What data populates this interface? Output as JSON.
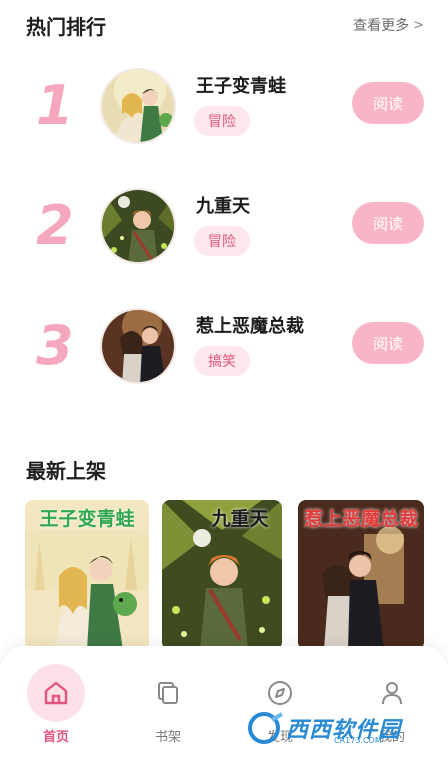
{
  "hot_section": {
    "title": "热门排行",
    "more": "查看更多"
  },
  "rankings": [
    {
      "rank": "1",
      "title": "王子变青蛙",
      "genre": "冒险",
      "action": "阅读"
    },
    {
      "rank": "2",
      "title": "九重天",
      "genre": "冒险",
      "action": "阅读"
    },
    {
      "rank": "3",
      "title": "惹上恶魔总裁",
      "genre": "搞笑",
      "action": "阅读"
    }
  ],
  "new_section": {
    "title": "最新上架",
    "cards": [
      {
        "title": "王子变青蛙",
        "title_color": "#2fa84f"
      },
      {
        "title": "九重天",
        "title_color": "#1b1b1b"
      },
      {
        "title": "惹上恶魔总裁",
        "title_color": "#e23b3b"
      }
    ]
  },
  "bottom_nav": [
    {
      "label": "首页",
      "icon": "home-icon",
      "active": true
    },
    {
      "label": "书架",
      "icon": "bookshelf-icon",
      "active": false
    },
    {
      "label": "发现",
      "icon": "compass-icon",
      "active": false
    },
    {
      "label": "我的",
      "icon": "user-icon",
      "active": false
    }
  ],
  "watermark": {
    "text": "西西软件园",
    "sub": "CR173.COM"
  },
  "colors": {
    "accent": "#e2557e",
    "rank_number": "#f4a7bd",
    "read_button": "#f8b5c7",
    "tag_bg": "#fde6ec"
  }
}
